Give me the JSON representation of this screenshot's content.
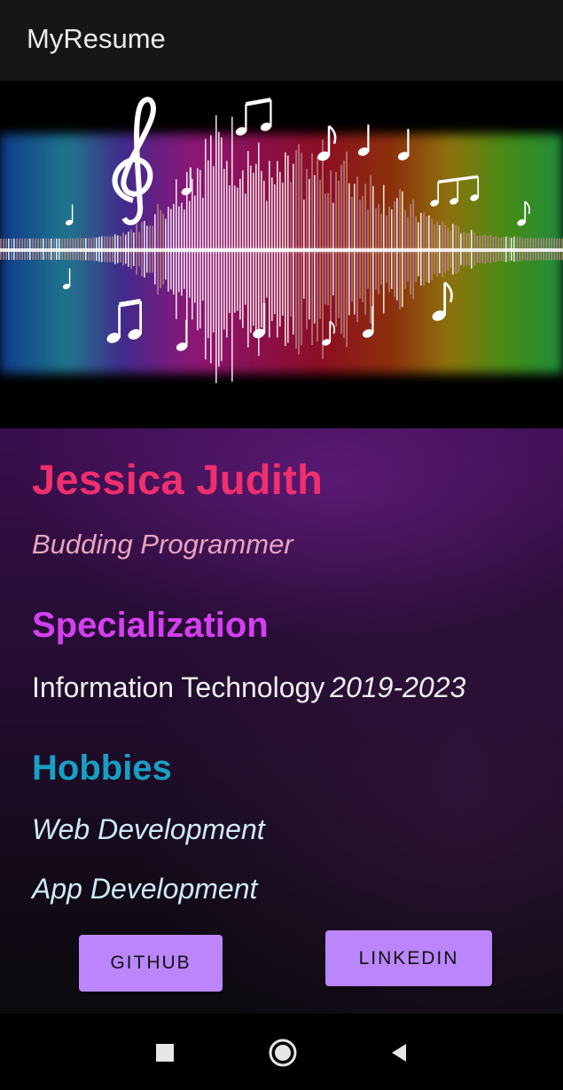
{
  "app_bar": {
    "title": "MyResume"
  },
  "hero": {
    "image_icon": "music-waveform-banner"
  },
  "profile": {
    "name": "Jessica Judith",
    "tagline": "Budding Programmer"
  },
  "specialization": {
    "heading": "Specialization",
    "field": "Information Technology",
    "years": "2019-2023"
  },
  "hobbies": {
    "heading": "Hobbies",
    "items": [
      "Web Development",
      "App Development"
    ]
  },
  "buttons": {
    "github_label": "GITHUB",
    "linkedin_label": "LINKEDIN"
  },
  "nav": {
    "recents_icon": "square-icon",
    "home_icon": "circle-icon",
    "back_icon": "triangle-back-icon"
  },
  "colors": {
    "name": "#ef2f6e",
    "tagline": "#e7a4bd",
    "specialization_heading": "#d53ff0",
    "hobbies_heading": "#1a9fc4",
    "hobby_text": "#cdeaf6",
    "button": "#bb86fc",
    "app_bar": "#161616"
  }
}
